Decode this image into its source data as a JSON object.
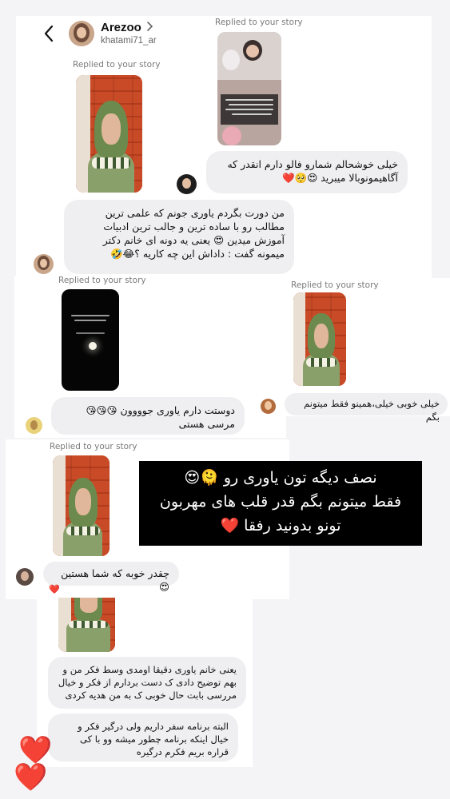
{
  "header": {
    "username": "Arezoo",
    "handle": "khatami71_ar",
    "back_icon": "chevron-left-icon",
    "more_icon": "chevron-right-icon"
  },
  "replied_label": "Replied to your story",
  "messages": [
    {
      "id": "m1",
      "text": "خیلی خوشحالم شمارو فالو دارم انقدر که آگاهیمونوبالا میبرید 😍🥺❤️"
    },
    {
      "id": "m2",
      "text": "من دورت بگردم یاوری جونم که علمی ترین مطالب رو با ساده ترین و جالب ترین ادبیات آموزش میدین 😍 یعنی یه دونه ای خانم دکتر میمونه گفت : داداش این چه کاریه ؟😂🤣"
    },
    {
      "id": "m3",
      "text": "خیلی خوبی خیلی،همینو فقط میتونم بگم"
    },
    {
      "id": "m4",
      "text": "دوستت دارم یاوری جوووون 😘😘😘مرسی هستی"
    },
    {
      "id": "m5",
      "text": "چقدر خوبه که شما هستین 😍"
    },
    {
      "id": "m6",
      "text": "یعنی خانم یاوری دقیقا اومدی وسط فکر من و بهم توضیح دادی ک دست بردارم از فکر و خیال مررسی بابت حال خوبی ک به من هدیه کردی"
    },
    {
      "id": "m7",
      "text": "البته برنامه سفر داریم ولی درگیر فکر و خیال اینکه برنامه چطور میشه وو با کی قراره بریم فکرم درگیره"
    }
  ],
  "banner": {
    "line1": "نصف دیگه تون یاوری رو 🫠😍",
    "line2": "فقط میتونم بگم قدر قلب های مهربون",
    "line3": "تونو بدونید رفقا ❤️"
  },
  "reaction_heart": "❤️",
  "big_hearts": [
    "❤️",
    "❤️"
  ],
  "colors": {
    "bubble": "#efeff1",
    "banner_bg": "#000000",
    "heart": "#e11d2a"
  }
}
